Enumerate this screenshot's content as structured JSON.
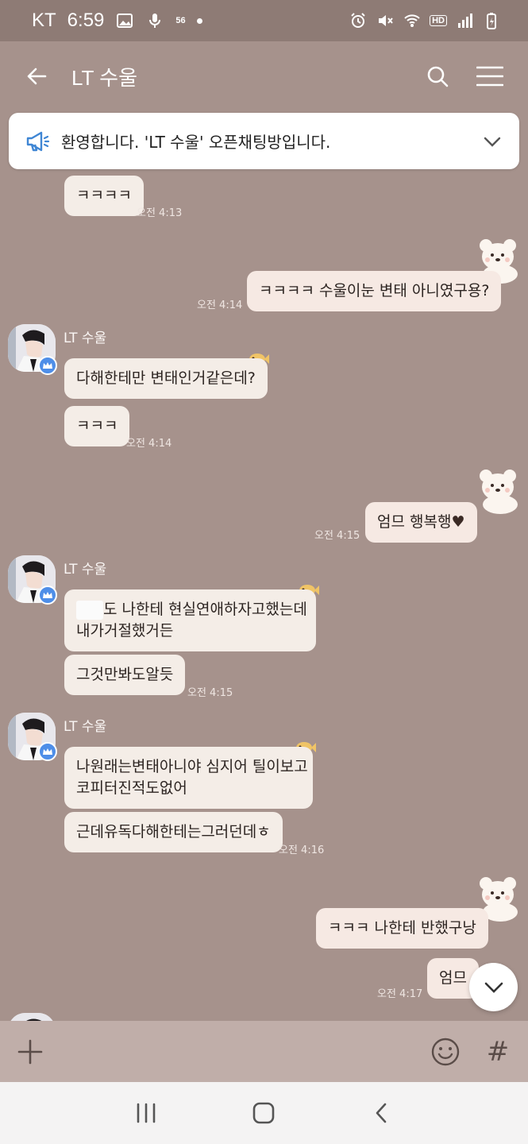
{
  "status_bar": {
    "carrier": "KT",
    "time": "6:59",
    "network_badge": "56",
    "hd_badge": "HD"
  },
  "header": {
    "title": "LT 수울"
  },
  "notice": {
    "text": "환영합니다. 'LT 수울' 오픈채팅방입니다."
  },
  "messages": [
    {
      "text": "ㅋㅋㅋㅋ",
      "time": "오전 4:13"
    },
    {
      "text": "ㅋㅋㅋㅋ 수울이눈 변태 아니였구용?",
      "time": "오전 4:14"
    },
    {
      "sender": "LT 수울",
      "text": "다해한테만 변태인거같은데?"
    },
    {
      "text": "ㅋㅋㅋ",
      "time": "오전 4:14"
    },
    {
      "text": "엄므 행복행",
      "time": "오전 4:15"
    },
    {
      "sender": "LT 수울",
      "line1": "도 나한테 현실연애하자고했는데",
      "line2": "내가거절했거든"
    },
    {
      "text": "그것만봐도알듯",
      "time": "오전 4:15"
    },
    {
      "sender": "LT 수울",
      "line1": "나원래는변태아니야 심지어 틸이보고",
      "line2": "코피터진적도없어"
    },
    {
      "text": "근데유독다해한테는그러던데ㅎ",
      "time": "오전 4:16"
    },
    {
      "text": "ㅋㅋㅋ 나한테 반했구낭",
      "time": ""
    },
    {
      "text": "엄므",
      "time": "오전 4:17"
    }
  ],
  "icons": {
    "back": "arrow-left-icon",
    "search": "search-icon",
    "menu": "hamburger-menu-icon",
    "notice": "megaphone-icon",
    "expand": "chevron-down-icon",
    "attach": "plus-icon",
    "emoji": "smiley-icon",
    "hashtag": "#"
  },
  "colors": {
    "background": "#a6928c",
    "bubble": "#f4ede7",
    "crown_badge": "#4e8ee8"
  }
}
